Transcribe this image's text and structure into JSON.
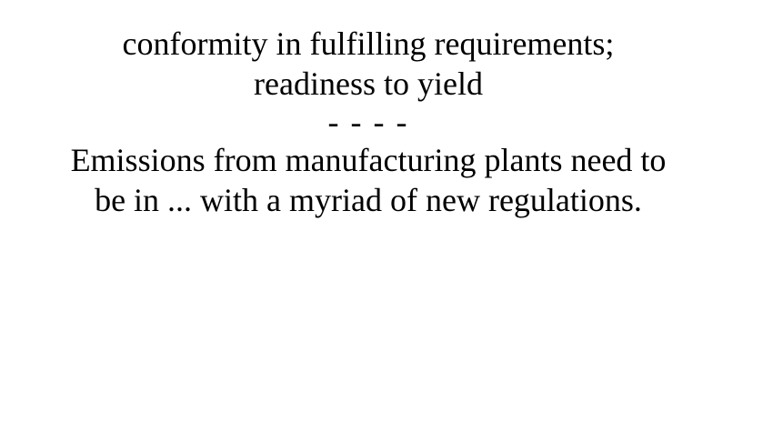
{
  "card": {
    "definition_lines": [
      "conformity in fulfilling requirements;",
      "readiness to yield"
    ],
    "separator": "- - - -",
    "example_lines": [
      "Emissions from manufacturing plants need to",
      "be in ... with a myriad of new regulations."
    ]
  }
}
